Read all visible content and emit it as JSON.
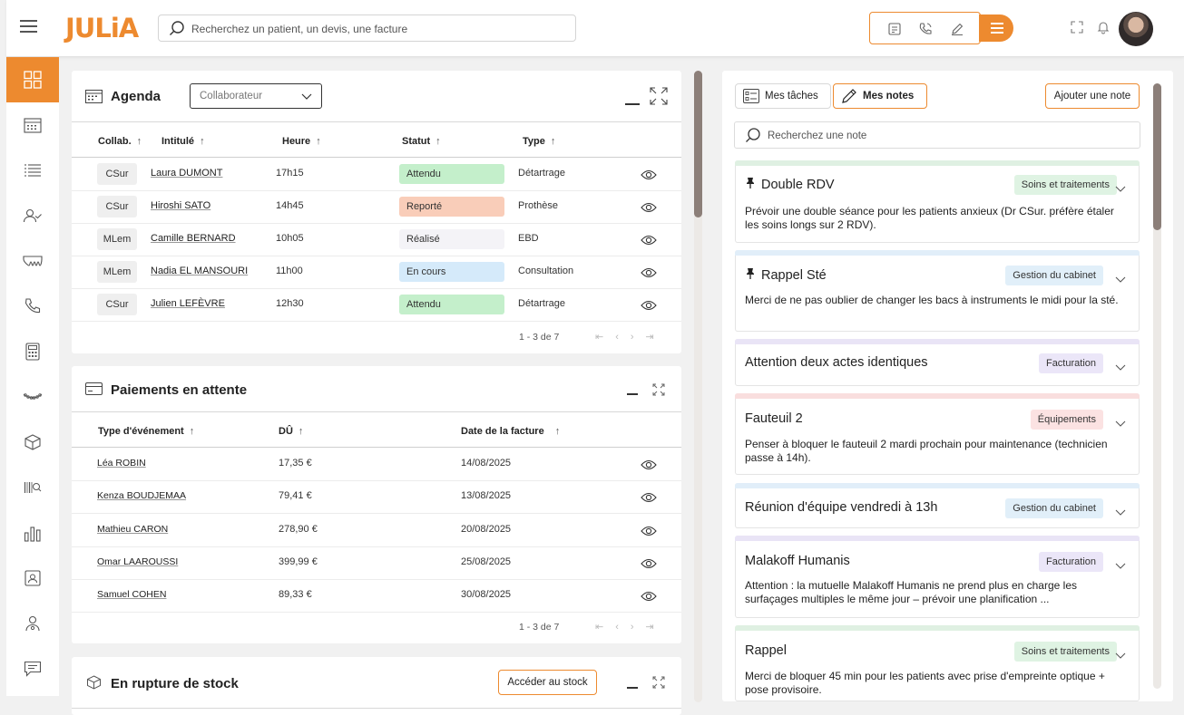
{
  "app": {
    "logo": "JULiA"
  },
  "header": {
    "search_placeholder": "Recherchez un patient, un devis, une facture"
  },
  "sidebar": {
    "items": [
      "dashboard-icon",
      "calendar-icon",
      "list-icon",
      "patients-icon",
      "dental-icon",
      "phone-icon",
      "calculator-icon",
      "dental-arch-icon",
      "box-icon",
      "barcode-icon",
      "chart-icon",
      "contact-card-icon",
      "settings-user-icon",
      "chat-icon"
    ]
  },
  "agenda": {
    "title": "Agenda",
    "collaborator_placeholder": "Collaborateur",
    "columns": [
      "Collab.",
      "Intitulé",
      "Heure",
      "Statut",
      "Type"
    ],
    "rows": [
      {
        "collab": "CSur",
        "name": "Laura DUMONT",
        "time": "17h15",
        "status": "Attendu",
        "status_color": "#c4efcb",
        "type": "Détartrage"
      },
      {
        "collab": "CSur",
        "name": "Hiroshi SATO",
        "time": "14h45",
        "status": "Reporté",
        "status_color": "#f9cdb9",
        "type": "Prothèse"
      },
      {
        "collab": "MLem",
        "name": "Camille BERNARD",
        "time": "10h05",
        "status": "Réalisé",
        "status_color": "#f4f3f7",
        "type": "EBD"
      },
      {
        "collab": "MLem",
        "name": "Nadia EL MANSOURI",
        "time": "11h00",
        "status": "En cours",
        "status_color": "#d5eafa",
        "type": "Consultation"
      },
      {
        "collab": "CSur",
        "name": "Julien LEFÈVRE",
        "time": "12h30",
        "status": "Attendu",
        "status_color": "#c4efcb",
        "type": "Détartrage"
      }
    ],
    "pager": "1 - 3 de 7"
  },
  "payments": {
    "title": "Paiements en attente",
    "columns": [
      "Type d'événement",
      "DÛ",
      "Date de la facture"
    ],
    "rows": [
      {
        "name": "Léa ROBIN",
        "amount": "17,35 €",
        "date": "14/08/2025"
      },
      {
        "name": "Kenza BOUDJEMAA",
        "amount": "79,41 €",
        "date": "13/08/2025"
      },
      {
        "name": "Mathieu CARON",
        "amount": "278,90 €",
        "date": "20/08/2025"
      },
      {
        "name": "Omar LAAROUSSI",
        "amount": "399,99 €",
        "date": "25/08/2025"
      },
      {
        "name": "Samuel COHEN",
        "amount": "89,33 €",
        "date": "30/08/2025"
      }
    ],
    "pager": "1 - 3 de 7"
  },
  "stock": {
    "title": "En rupture de stock",
    "button": "Accéder au stock"
  },
  "notes": {
    "tab_tasks": "Mes tâches",
    "tab_notes": "Mes notes",
    "add_button": "Ajouter une note",
    "search_placeholder": "Recherchez une note",
    "items": [
      {
        "title": "Double RDV",
        "pinned": true,
        "tag": "Soins et traitements",
        "tag_color": "#dff3e3",
        "bar_color": "#dff0e2",
        "body": "Prévoir une double séance pour les patients anxieux (Dr CSur. préfère étaler les soins longs sur 2 RDV)."
      },
      {
        "title": "Rappel Sté",
        "pinned": true,
        "tag": "Gestion du cabinet",
        "tag_color": "#e1eff9",
        "bar_color": "#e1eef9",
        "body": "Merci de ne pas oublier de changer les bacs à instruments le midi pour la sté."
      },
      {
        "title": "Attention deux actes identiques",
        "pinned": false,
        "tag": "Facturation",
        "tag_color": "#ebe6f8",
        "bar_color": "#e9e4f6",
        "body": ""
      },
      {
        "title": "Fauteuil 2",
        "pinned": false,
        "tag": "Équipements",
        "tag_color": "#fbe2e2",
        "bar_color": "#f9dede",
        "body": "Penser à bloquer le fauteuil 2 mardi prochain pour maintenance (technicien passe à 14h)."
      },
      {
        "title": "Réunion d'équipe vendredi à 13h",
        "pinned": false,
        "tag": "Gestion du cabinet",
        "tag_color": "#e1eff9",
        "bar_color": "#e1eef9",
        "body": ""
      },
      {
        "title": "Malakoff Humanis",
        "pinned": false,
        "tag": "Facturation",
        "tag_color": "#ebe6f8",
        "bar_color": "#e9e4f6",
        "body": "Attention : la mutuelle Malakoff Humanis ne prend plus en charge les surfaçages multiples le même jour – prévoir une planification ..."
      },
      {
        "title": "Rappel",
        "pinned": false,
        "tag": "Soins et traitements",
        "tag_color": "#dff3e3",
        "bar_color": "#dff0e2",
        "body": "Merci de bloquer 45 min pour les patients avec prise d'empreinte optique + pose provisoire."
      }
    ]
  },
  "colors": {
    "accent": "#ed8a2f"
  }
}
